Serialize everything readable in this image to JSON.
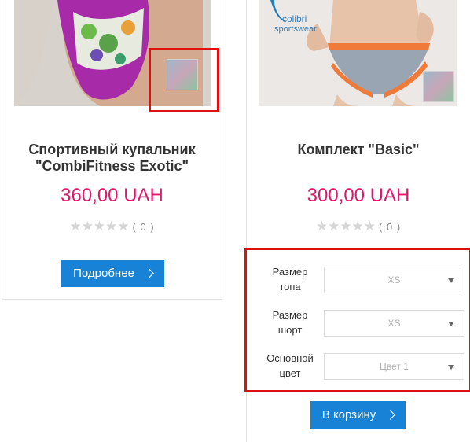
{
  "products": [
    {
      "title_line1": "Спортивный купальник",
      "title_line2": "\"CombiFitness Exotic\"",
      "price": "360,00 UAH",
      "rating_count": "( 0 )",
      "button_label": "Подробнее"
    },
    {
      "brand_text_1": "colibri",
      "brand_text_2": "sportswear",
      "title_line1": "Комплект \"Basic\"",
      "price": "300,00 UAH",
      "rating_count": "( 0 )",
      "options": [
        {
          "label_line1": "Размер",
          "label_line2": "топа",
          "value": "XS"
        },
        {
          "label_line1": "Размер",
          "label_line2": "шорт",
          "value": "XS"
        },
        {
          "label_line1": "Основной",
          "label_line2": "цвет",
          "value": "Цвет 1"
        }
      ],
      "button_label": "В корзину"
    }
  ],
  "colors": {
    "price": "#e0186c",
    "button": "#1883d6",
    "highlight": "#e01010"
  }
}
